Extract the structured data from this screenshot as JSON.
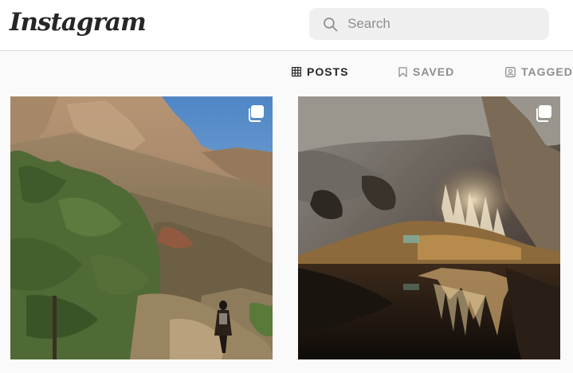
{
  "header": {
    "logo_text": "Instagram",
    "search": {
      "placeholder": "Search"
    }
  },
  "tabs": [
    {
      "label": "POSTS",
      "icon": "grid-icon",
      "active": true
    },
    {
      "label": "SAVED",
      "icon": "bookmark-icon",
      "active": false
    },
    {
      "label": "TAGGED",
      "icon": "tagged-icon",
      "active": false
    }
  ],
  "posts": [
    {
      "alt": "",
      "icon": "multiple-posts-icon"
    },
    {
      "alt": "",
      "icon": "multiple-posts-icon"
    }
  ],
  "colors": {
    "text": "#262626",
    "muted": "#8e8e8e",
    "search_bg": "#efefef",
    "border": "#dbdbdb",
    "background": "#fafafa"
  }
}
